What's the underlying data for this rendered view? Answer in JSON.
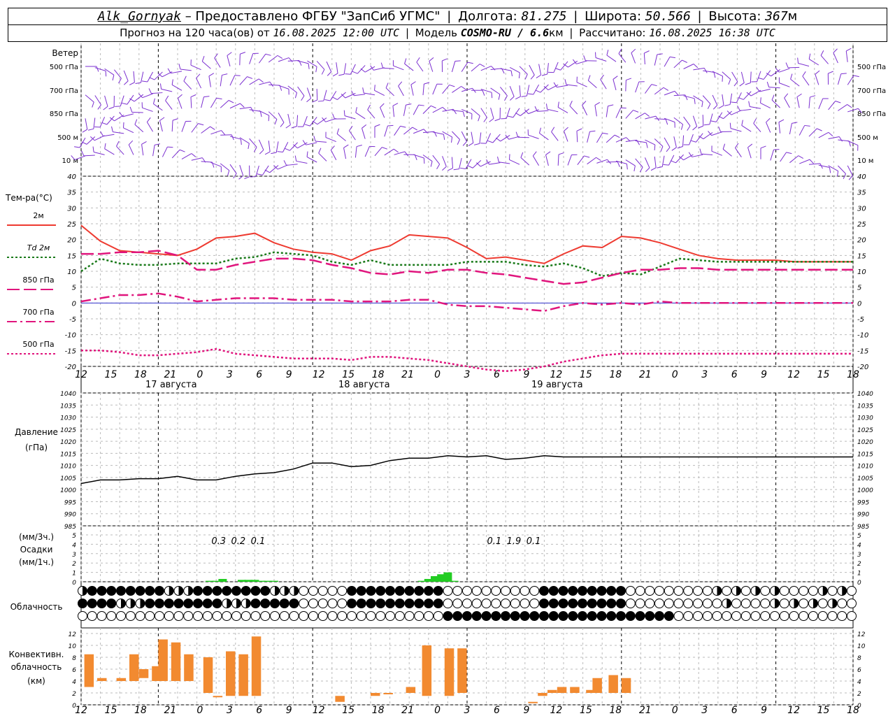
{
  "header": {
    "station": "Alk_Gornyak",
    "provider": "– Предоставлено ФГБУ \"ЗапСиб УГМС\"",
    "lon_label": "Долгота:",
    "lon_value": "81.275",
    "lat_label": "Широта:",
    "lat_value": "50.566",
    "alt_label": "Высота:",
    "alt_value": "367",
    "alt_unit": "м",
    "forecast_label": "Прогноз на 120 часа(ов) от",
    "forecast_start": "16.08.2025 12:00 UTC",
    "model_label": "Модель",
    "model_name": "COSMO-RU / 6.6",
    "model_unit": "км",
    "computed_label": "Рассчитано:",
    "computed_value": "16.08.2025 16:38 UTC"
  },
  "chart_data": [
    {
      "type": "wind-barbs",
      "title": "Ветер",
      "levels": [
        "500 гПа",
        "700 гПа",
        "850 гПа",
        "500 м",
        "10  м"
      ],
      "color": "#7b2fd0"
    },
    {
      "type": "line",
      "ylabel": "Тем-ра(°С)",
      "ylim": [
        -20,
        40
      ],
      "yticks": [
        40,
        35,
        30,
        25,
        20,
        15,
        10,
        5,
        0,
        -5,
        -10,
        -15,
        -20
      ],
      "x_ticks": [
        "12",
        "15",
        "18",
        "21",
        "0",
        "3",
        "6",
        "9",
        "12",
        "15",
        "18",
        "21",
        "0",
        "3",
        "6",
        "9",
        "12",
        "15",
        "18",
        "21",
        "0",
        "3",
        "6",
        "9",
        "12",
        "15",
        "18"
      ],
      "day_labels": [
        {
          "hour": 24,
          "label": "17 августа"
        },
        {
          "hour": 48,
          "label": "18 августа"
        },
        {
          "hour": 72,
          "label": "19 августа"
        }
      ],
      "legend": [
        {
          "name": "2м",
          "color": "#ee3a30",
          "style": "solid"
        },
        {
          "name": "Td 2м",
          "color": "#1a7a1a",
          "style": "dotted"
        },
        {
          "name": "850 гПа",
          "color": "#e0157d",
          "style": "dashed"
        },
        {
          "name": "700 гПа",
          "color": "#e0157d",
          "style": "dashdot"
        },
        {
          "name": "500 гПа",
          "color": "#e0157d",
          "style": "dotted"
        }
      ],
      "series": [
        {
          "name": "2м",
          "x": [
            0,
            3,
            6,
            9,
            12,
            15,
            18,
            21,
            24,
            27,
            30,
            33,
            36,
            39,
            42,
            45,
            48,
            51,
            54,
            57,
            60,
            63,
            66,
            69,
            72,
            75,
            78,
            81,
            84,
            87,
            90,
            93,
            96,
            99,
            102,
            105,
            108,
            111,
            114,
            117,
            120
          ],
          "values": [
            24.5,
            19.5,
            16.5,
            16.0,
            15.5,
            15.0,
            17.0,
            20.5,
            21.0,
            22.0,
            19.0,
            17.0,
            16.0,
            15.5,
            13.5,
            16.5,
            18.0,
            21.5,
            21.0,
            20.5,
            17.5,
            14.0,
            14.5,
            13.5,
            12.5,
            15.5,
            18.0,
            17.5,
            21.0,
            20.5,
            19.0,
            17.0,
            15.0,
            14.0,
            13.5,
            13.5,
            13.5,
            13.0,
            13.0,
            13.0,
            13.0
          ]
        },
        {
          "name": "Td 2м",
          "x": [
            0,
            3,
            6,
            9,
            12,
            15,
            18,
            21,
            24,
            27,
            30,
            33,
            36,
            39,
            42,
            45,
            48,
            51,
            54,
            57,
            60,
            63,
            66,
            69,
            72,
            75,
            78,
            81,
            84,
            87,
            90,
            93,
            96,
            99,
            102,
            105,
            108,
            111,
            114,
            117,
            120
          ],
          "values": [
            10.0,
            14.0,
            12.5,
            12.0,
            12.0,
            12.5,
            12.5,
            12.5,
            14.0,
            14.5,
            16.0,
            15.5,
            15.0,
            13.0,
            12.0,
            13.5,
            12.0,
            12.0,
            12.0,
            12.0,
            13.0,
            13.0,
            13.0,
            12.0,
            11.5,
            12.5,
            11.0,
            8.5,
            9.5,
            9.0,
            11.5,
            14.0,
            13.5,
            13.0,
            13.0,
            13.0,
            13.0,
            13.0,
            13.0,
            13.0,
            13.0
          ]
        },
        {
          "name": "850 гПа",
          "x": [
            0,
            3,
            6,
            9,
            12,
            15,
            18,
            21,
            24,
            27,
            30,
            33,
            36,
            39,
            42,
            45,
            48,
            51,
            54,
            57,
            60,
            63,
            66,
            69,
            72,
            75,
            78,
            81,
            84,
            87,
            90,
            93,
            96,
            99,
            102,
            105,
            108,
            111,
            114,
            117,
            120
          ],
          "values": [
            15.5,
            15.5,
            16.0,
            16.0,
            16.5,
            15.0,
            10.5,
            10.5,
            12.0,
            13.0,
            14.0,
            14.0,
            13.5,
            12.0,
            11.0,
            9.5,
            9.0,
            10.0,
            9.5,
            10.5,
            10.5,
            9.5,
            9.0,
            8.0,
            7.0,
            6.0,
            6.5,
            8.0,
            9.5,
            10.5,
            10.5,
            11.0,
            11.0,
            10.5,
            10.5,
            10.5,
            10.5,
            10.5,
            10.5,
            10.5,
            10.5
          ]
        },
        {
          "name": "700 гПа",
          "x": [
            0,
            3,
            6,
            9,
            12,
            15,
            18,
            21,
            24,
            27,
            30,
            33,
            36,
            39,
            42,
            45,
            48,
            51,
            54,
            57,
            60,
            63,
            66,
            69,
            72,
            75,
            78,
            81,
            84,
            87,
            90,
            93,
            96,
            99,
            102,
            105,
            108,
            111,
            114,
            117,
            120
          ],
          "values": [
            0.5,
            1.5,
            2.5,
            2.5,
            3.0,
            2.0,
            0.5,
            1.0,
            1.5,
            1.5,
            1.5,
            1.0,
            1.0,
            1.0,
            0.5,
            0.5,
            0.5,
            1.0,
            1.0,
            -0.5,
            -1.0,
            -1.0,
            -1.5,
            -2.0,
            -2.5,
            -1.0,
            0.0,
            -0.5,
            0.0,
            -0.5,
            0.5,
            0.0,
            0.0,
            0.0,
            0.0,
            0.0,
            0.0,
            0.0,
            0.0,
            0.0,
            0.0
          ]
        },
        {
          "name": "500 гПа",
          "x": [
            0,
            3,
            6,
            9,
            12,
            15,
            18,
            21,
            24,
            27,
            30,
            33,
            36,
            39,
            42,
            45,
            48,
            51,
            54,
            57,
            60,
            63,
            66,
            69,
            72,
            75,
            78,
            81,
            84,
            87,
            90,
            93,
            96,
            99,
            102,
            105,
            108,
            111,
            114,
            117,
            120
          ],
          "values": [
            -15.0,
            -15.0,
            -15.5,
            -16.5,
            -16.5,
            -16.0,
            -15.5,
            -14.5,
            -16.0,
            -16.5,
            -17.0,
            -17.5,
            -17.5,
            -17.5,
            -18.0,
            -17.0,
            -17.0,
            -17.5,
            -18.0,
            -19.0,
            -20.0,
            -21.0,
            -21.5,
            -21.0,
            -20.0,
            -18.5,
            -17.5,
            -16.5,
            -16.0,
            -16.0,
            -16.0,
            -16.0,
            -16.0,
            -16.0,
            -16.0,
            -16.0,
            -16.0,
            -16.0,
            -16.0,
            -16.0,
            -16.0
          ]
        }
      ]
    },
    {
      "type": "line",
      "ylabel": "Давление",
      "yunit": "(гПа)",
      "ylim": [
        985,
        1040
      ],
      "yticks": [
        1040,
        1035,
        1030,
        1025,
        1020,
        1015,
        1010,
        1005,
        1000,
        995,
        990,
        985
      ],
      "series": [
        {
          "name": "Давление",
          "x": [
            0,
            3,
            6,
            9,
            12,
            15,
            18,
            21,
            24,
            27,
            30,
            33,
            36,
            39,
            42,
            45,
            48,
            51,
            54,
            57,
            60,
            63,
            66,
            69,
            72,
            75,
            78,
            81,
            84,
            87,
            90,
            93,
            96,
            99,
            102,
            105,
            108,
            111,
            114,
            117,
            120
          ],
          "values": [
            1002.5,
            1004.0,
            1004.0,
            1004.5,
            1004.5,
            1005.5,
            1004.0,
            1004.0,
            1005.5,
            1006.5,
            1007.0,
            1008.5,
            1011.0,
            1011.0,
            1009.5,
            1010.0,
            1012.0,
            1013.0,
            1013.0,
            1014.0,
            1013.5,
            1014.0,
            1012.5,
            1013.0,
            1014.0,
            1013.5,
            1013.5,
            1013.5,
            1013.5,
            1013.5,
            1013.5,
            1013.5,
            1013.5,
            1013.5,
            1013.5,
            1013.5,
            1013.5,
            1013.5,
            1013.5,
            1013.5,
            1013.5
          ]
        }
      ]
    },
    {
      "type": "bar",
      "ylabel_top": "(мм/3ч.)",
      "ylabel": "Осадки",
      "yunit": "(мм/1ч.)",
      "ylim": [
        0,
        5
      ],
      "yticks": [
        5,
        4,
        3,
        2,
        1,
        0
      ],
      "labels": [
        {
          "hour": 19,
          "text": "0.3"
        },
        {
          "hour": 22,
          "text": "0.2"
        },
        {
          "hour": 25,
          "text": "0.1"
        },
        {
          "hour": 61,
          "text": "0.1"
        },
        {
          "hour": 64,
          "text": "1.9"
        },
        {
          "hour": 67,
          "text": "0.1"
        }
      ],
      "x": [
        16,
        17,
        18,
        19,
        20,
        21,
        22,
        23,
        24,
        25,
        26,
        27,
        49,
        50,
        51,
        52,
        53,
        54
      ],
      "values": [
        0.1,
        0.1,
        0.3,
        0.0,
        0.0,
        0.2,
        0.2,
        0.2,
        0.1,
        0.1,
        0.1,
        0.0,
        0.1,
        0.3,
        0.6,
        0.8,
        1.0,
        0.1
      ]
    },
    {
      "type": "table",
      "ylabel": "Облачность",
      "rows": 3,
      "legend": "○ clear · ◑ partial · ● overcast"
    },
    {
      "type": "bar",
      "ylabel": "Конвективн. облачность",
      "yunit": "(км)",
      "ylim": [
        0,
        12
      ],
      "yticks": [
        12,
        10,
        8,
        6,
        4,
        2,
        0
      ],
      "ranges": [
        [
          0.5,
          3.0,
          8.5
        ],
        [
          2.5,
          4.0,
          4.5
        ],
        [
          5.5,
          4.0,
          4.5
        ],
        [
          7.5,
          4.0,
          8.5
        ],
        [
          9.0,
          4.5,
          6.0
        ],
        [
          11.0,
          4.0,
          6.5
        ],
        [
          12.0,
          4.0,
          11.0
        ],
        [
          14.0,
          4.0,
          10.5
        ],
        [
          16.0,
          4.0,
          8.5
        ],
        [
          19.0,
          2.0,
          8.0
        ],
        [
          20.5,
          1.5,
          1.5
        ],
        [
          22.5,
          1.5,
          9.0
        ],
        [
          24.5,
          1.5,
          8.5
        ],
        [
          26.5,
          1.5,
          11.5
        ],
        [
          39.5,
          0.5,
          1.5
        ],
        [
          45.0,
          1.5,
          2.0
        ],
        [
          47.0,
          2.0,
          2.0
        ],
        [
          50.5,
          2.0,
          3.0
        ],
        [
          53.0,
          1.5,
          10.0
        ],
        [
          56.5,
          1.5,
          9.5
        ],
        [
          58.5,
          2.0,
          9.5
        ],
        [
          69.5,
          0.5,
          0.5
        ],
        [
          71.0,
          1.5,
          2.0
        ],
        [
          72.5,
          2.0,
          2.5
        ],
        [
          74.0,
          2.0,
          3.0
        ],
        [
          76.0,
          2.0,
          3.0
        ],
        [
          78.5,
          2.0,
          2.5
        ],
        [
          79.5,
          2.0,
          4.5
        ],
        [
          82.0,
          2.0,
          5.0
        ],
        [
          84.0,
          2.0,
          4.5
        ]
      ],
      "color": "#f28a30"
    }
  ]
}
